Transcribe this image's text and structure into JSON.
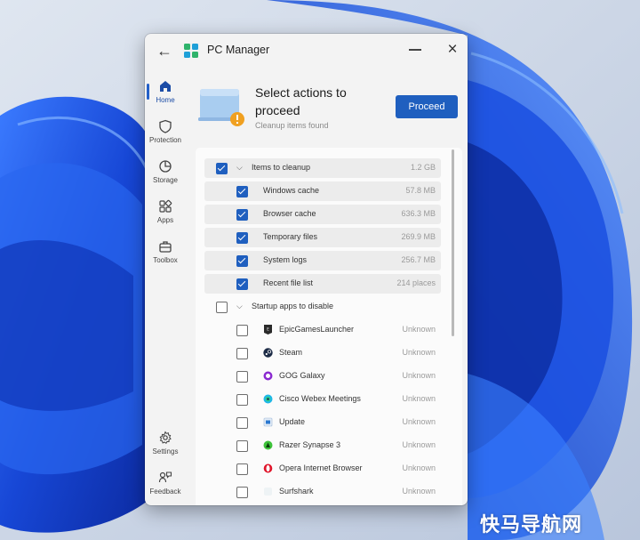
{
  "window": {
    "title": "PC Manager",
    "back_icon": "back-arrow-icon",
    "min_icon": "minimize-icon",
    "close_icon": "close-icon"
  },
  "nav": {
    "items": [
      {
        "label": "Home",
        "icon": "home-icon",
        "active": true
      },
      {
        "label": "Protection",
        "icon": "shield-icon",
        "active": false
      },
      {
        "label": "Storage",
        "icon": "pie-chart-icon",
        "active": false
      },
      {
        "label": "Apps",
        "icon": "apps-grid-icon",
        "active": false
      },
      {
        "label": "Toolbox",
        "icon": "toolbox-icon",
        "active": false
      }
    ],
    "bottom_items": [
      {
        "label": "Settings",
        "icon": "gear-icon"
      },
      {
        "label": "Feedback",
        "icon": "feedback-icon"
      }
    ]
  },
  "header": {
    "title": "Select actions to proceed",
    "subtitle": "Cleanup items found",
    "proceed_label": "Proceed"
  },
  "cleanup_group": {
    "label": "Items to cleanup",
    "size": "1.2 GB",
    "checked": true,
    "items": [
      {
        "label": "Windows cache",
        "value": "57.8 MB",
        "checked": true
      },
      {
        "label": "Browser cache",
        "value": "636.3 MB",
        "checked": true
      },
      {
        "label": "Temporary files",
        "value": "269.9 MB",
        "checked": true
      },
      {
        "label": "System logs",
        "value": "256.7 MB",
        "checked": true
      },
      {
        "label": "Recent file list",
        "value": "214 places",
        "checked": true
      }
    ]
  },
  "startup_group": {
    "label": "Startup apps to disable",
    "checked": false,
    "items": [
      {
        "label": "EpicGamesLauncher",
        "value": "Unknown",
        "icon": "epic-games-icon"
      },
      {
        "label": "Steam",
        "value": "Unknown",
        "icon": "steam-icon"
      },
      {
        "label": "GOG Galaxy",
        "value": "Unknown",
        "icon": "gog-galaxy-icon"
      },
      {
        "label": "Cisco Webex Meetings",
        "value": "Unknown",
        "icon": "webex-icon"
      },
      {
        "label": "Update",
        "value": "Unknown",
        "icon": "update-icon"
      },
      {
        "label": "Razer Synapse 3",
        "value": "Unknown",
        "icon": "razer-icon"
      },
      {
        "label": "Opera Internet Browser",
        "value": "Unknown",
        "icon": "opera-icon"
      },
      {
        "label": "Surfshark",
        "value": "Unknown",
        "icon": "surfshark-icon"
      }
    ]
  },
  "watermark": "快马导航网",
  "colors": {
    "accent": "#1f5fbf",
    "wallpaper_blue": "#1a55d8",
    "warning": "#f0a020"
  }
}
